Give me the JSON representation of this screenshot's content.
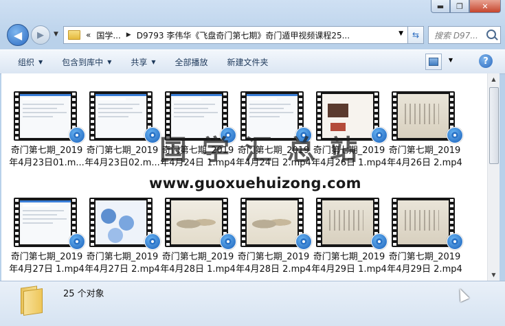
{
  "window": {
    "controls": {
      "minimize": "▬",
      "maximize": "❐",
      "close": "✕"
    }
  },
  "nav": {
    "back_icon": "back-arrow-icon",
    "breadcrumb_chevron": "«",
    "breadcrumb": [
      "国学...",
      "D9793 李伟华《飞盘奇门第七期》奇门遁甲视频课程25..."
    ],
    "search_placeholder": "搜索 D97..."
  },
  "toolbar": {
    "organize": "组织",
    "include_in_library": "包含到库中",
    "share": "共享",
    "play_all": "全部播放",
    "new_folder": "新建文件夹",
    "help": "?"
  },
  "files": [
    {
      "line1": "奇门第七期_2019",
      "line2": "年4月23日01.m...",
      "style": "s-doc"
    },
    {
      "line1": "奇门第七期_2019",
      "line2": "年4月23日02.m...",
      "style": "s-doc"
    },
    {
      "line1": "奇门第七期_2019",
      "line2": "年4月24日 1.mp4",
      "style": "s-doc"
    },
    {
      "line1": "奇门第七期_2019",
      "line2": "年4月24日 2.mp4",
      "style": "s-doc"
    },
    {
      "line1": "奇门第七期_2019",
      "line2": "年4月26日 1.mp4",
      "style": "s-red"
    },
    {
      "line1": "奇门第七期_2019",
      "line2": "年4月26日 2.mp4",
      "style": "s-paper"
    },
    {
      "line1": "奇门第七期_2019",
      "line2": "年4月27日 1.mp4",
      "style": "s-doc"
    },
    {
      "line1": "奇门第七期_2019",
      "line2": "年4月27日 2.mp4",
      "style": "s-blue"
    },
    {
      "line1": "奇门第七期_2019",
      "line2": "年4月28日 1.mp4",
      "style": "s-paint"
    },
    {
      "line1": "奇门第七期_2019",
      "line2": "年4月28日 2.mp4",
      "style": "s-paint"
    },
    {
      "line1": "奇门第七期_2019",
      "line2": "年4月29日 1.mp4",
      "style": "s-paper"
    },
    {
      "line1": "奇门第七期_2019",
      "line2": "年4月29日 2.mp4",
      "style": "s-paper"
    }
  ],
  "watermark": {
    "title": "国学汇总站",
    "url": "www.guoxuehuizong.com"
  },
  "details": {
    "item_count": "25 个对象"
  }
}
